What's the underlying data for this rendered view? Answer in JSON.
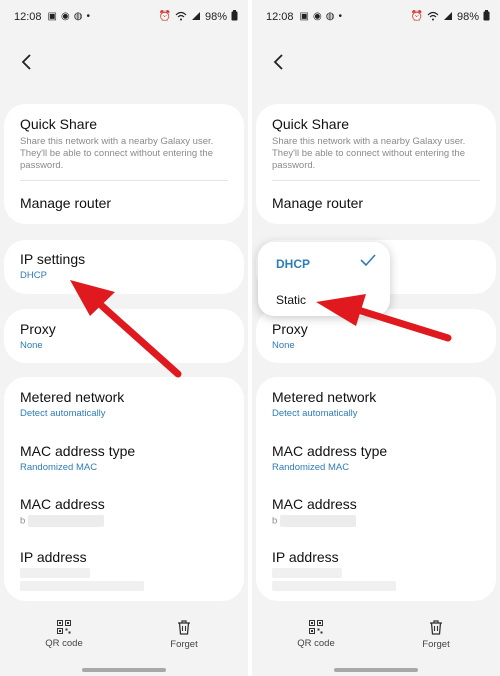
{
  "status_bar": {
    "time": "12:08",
    "battery": "98%"
  },
  "quick_share": {
    "title": "Quick Share",
    "description": "Share this network with a nearby Galaxy user. They'll be able to connect without entering the password."
  },
  "manage_router": {
    "title": "Manage router"
  },
  "ip_settings": {
    "title": "IP settings",
    "value": "DHCP"
  },
  "proxy": {
    "title": "Proxy",
    "value": "None"
  },
  "metered_network": {
    "title": "Metered network",
    "value": "Detect automatically"
  },
  "mac_address_type": {
    "title": "MAC address type",
    "value": "Randomized MAC"
  },
  "mac_address": {
    "title": "MAC address",
    "value_prefix": "b"
  },
  "ip_address": {
    "title": "IP address"
  },
  "bottom_nav": {
    "qr_label": "QR code",
    "forget_label": "Forget"
  },
  "ip_dropdown": {
    "options": [
      "DHCP",
      "Static"
    ],
    "selected": "DHCP"
  },
  "colors": {
    "accent": "#2e7cb8",
    "arrow": "#e0191f",
    "background": "#f3f3f3"
  },
  "icons": [
    "back-arrow-icon",
    "qr-code-icon",
    "trash-icon",
    "check-icon",
    "wifi-icon",
    "battery-icon",
    "alarm-icon"
  ]
}
